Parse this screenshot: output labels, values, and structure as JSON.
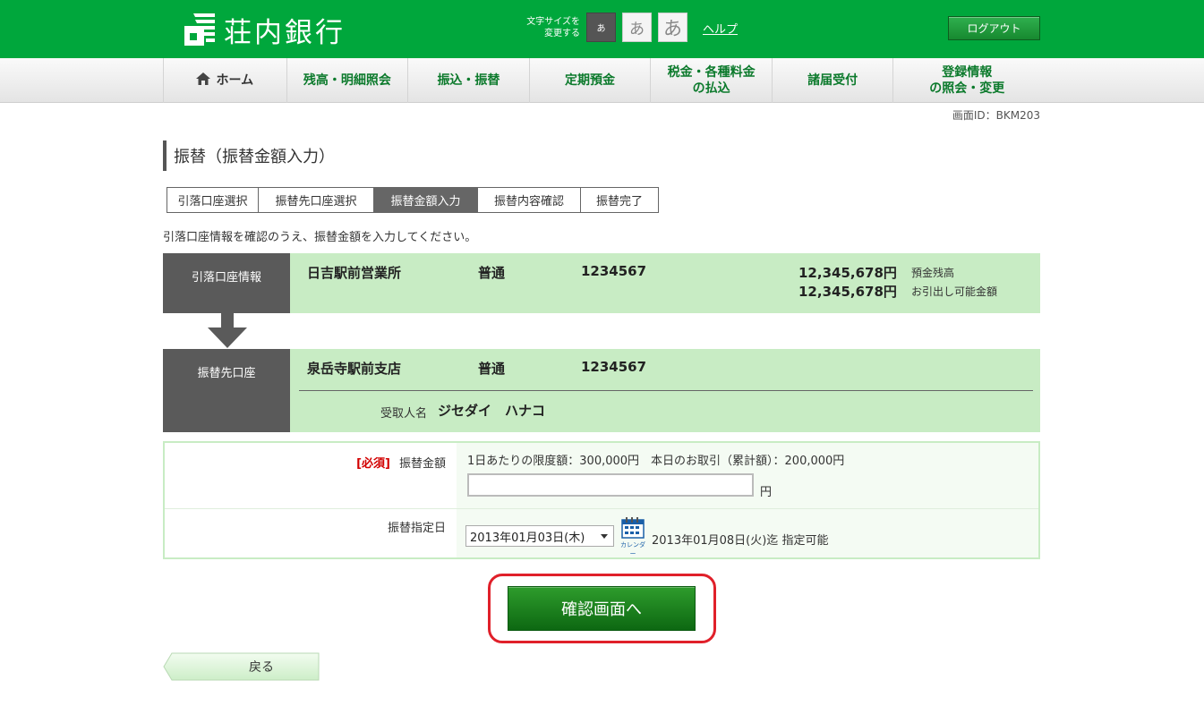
{
  "header": {
    "bank_name": "荘内銀行",
    "fontsize_label_line1": "文字サイズを",
    "fontsize_label_line2": "変更する",
    "fontsize_small": "あ",
    "fontsize_medium": "あ",
    "fontsize_large": "あ",
    "help": "ヘルプ",
    "logout": "ログアウト"
  },
  "nav": {
    "home": "ホーム",
    "balance_line1": "残高・明細照会",
    "transfer": "振込・振替",
    "time_deposit": "定期預金",
    "tax_line1": "税金・各種料金",
    "tax_line2": "の払込",
    "forms": "諸届受付",
    "reg_line1": "登録情報",
    "reg_line2": "の照会・変更"
  },
  "screen_id": "画面ID：BKM203",
  "page_title": "振替（振替金額入力）",
  "steps": [
    "引落口座選択",
    "振替先口座選択",
    "振替金額入力",
    "振替内容確認",
    "振替完了"
  ],
  "instruction": "引落口座情報を確認のうえ、振替金額を入力してください。",
  "source_account": {
    "label": "引落口座情報",
    "branch": "日吉駅前営業所",
    "type": "普通",
    "number": "1234567",
    "balance": "12,345,678円",
    "balance_label": "預金残高",
    "available": "12,345,678円",
    "available_label": "お引出し可能金額"
  },
  "dest_account": {
    "label": "振替先口座",
    "branch": "泉岳寺駅前支店",
    "type": "普通",
    "number": "1234567",
    "recipient_label": "受取人名",
    "recipient": "ジセダイ　ハナコ"
  },
  "form": {
    "required": "[必須]",
    "amount_label": "振替金額",
    "limit_text": "1日あたりの限度額：300,000円　本日のお取引（累計額）：200,000円",
    "amount_value": "",
    "yen": "円",
    "date_label": "振替指定日",
    "date_selected": "2013年01月03日(木)",
    "calendar_caption": "カレンダー",
    "date_note": "2013年01月08日(火)迄 指定可能"
  },
  "confirm_button": "確認画面へ",
  "back_button": "戻る",
  "colors": {
    "brand_green": "#00a73c",
    "account_bg": "#c8ecc4",
    "highlight_red": "#e0202a"
  }
}
